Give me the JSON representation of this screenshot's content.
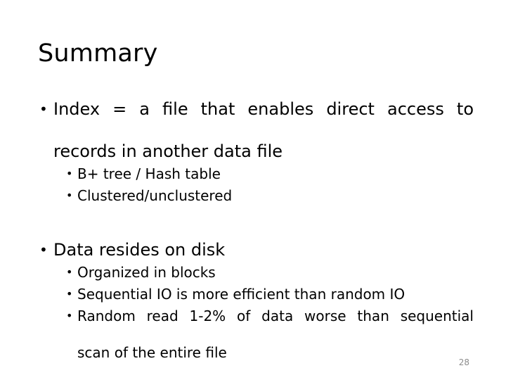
{
  "slide": {
    "title": "Summary",
    "page_number": "28",
    "bullet_glyph": "•",
    "colors": {
      "background": "#ffffff",
      "text": "#000000",
      "page_number": "#8c8c8c"
    },
    "content": [
      {
        "level": 1,
        "lines": [
          "Index = a file that enables direct access to",
          "records in another data file"
        ],
        "text": "Index = a file that enables direct access to records in another data file"
      },
      {
        "level": 2,
        "lines": [
          "B+ tree / Hash table"
        ],
        "text": "B+ tree / Hash table"
      },
      {
        "level": 2,
        "lines": [
          "Clustered/unclustered"
        ],
        "text": "Clustered/unclustered"
      },
      {
        "level": 1,
        "lines": [
          "Data resides on disk"
        ],
        "text": "Data resides on disk"
      },
      {
        "level": 2,
        "lines": [
          "Organized in blocks"
        ],
        "text": "Organized in blocks"
      },
      {
        "level": 2,
        "lines": [
          "Sequential IO is more efficient than random IO"
        ],
        "text": "Sequential IO is more efficient than random IO"
      },
      {
        "level": 2,
        "lines": [
          "Random read 1-2% of data worse than sequential",
          "scan of the entire file"
        ],
        "text": "Random read 1-2% of data worse than sequential scan of the entire file"
      }
    ]
  }
}
